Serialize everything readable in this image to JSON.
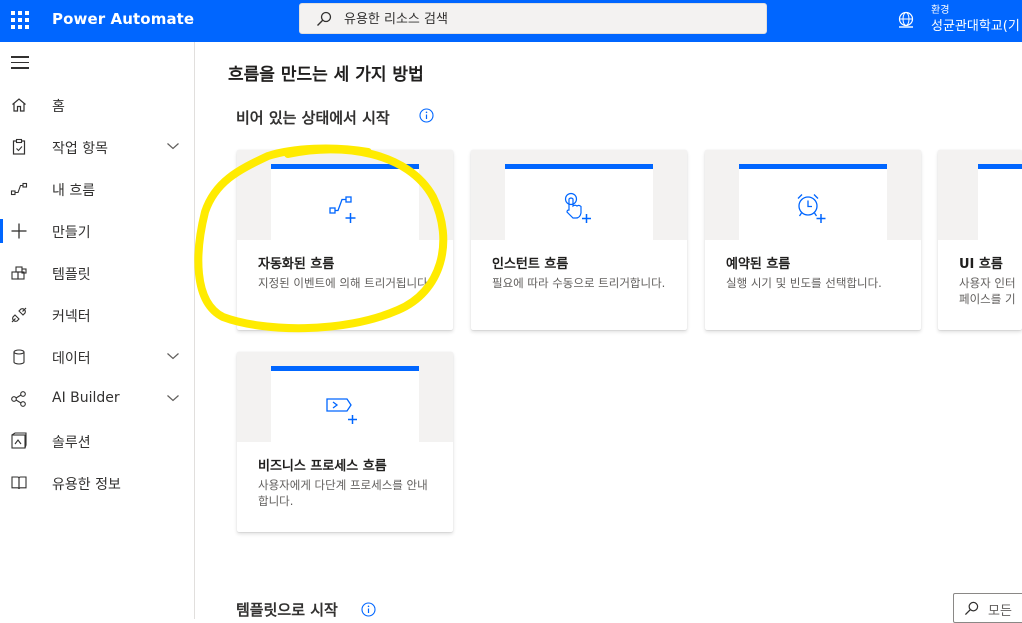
{
  "app": {
    "title": "Power Automate",
    "search_placeholder": "유용한 리소스 검색",
    "environment_label": "환경",
    "environment_name": "성균관대학교(기"
  },
  "sidebar": {
    "items": [
      {
        "label": "홈",
        "icon": "home-icon"
      },
      {
        "label": "작업 항목",
        "icon": "clipboard-icon",
        "expandable": true
      },
      {
        "label": "내 흐름",
        "icon": "flow-icon"
      },
      {
        "label": "만들기",
        "icon": "plus-icon",
        "active": true
      },
      {
        "label": "템플릿",
        "icon": "template-icon"
      },
      {
        "label": "커넥터",
        "icon": "connector-icon"
      },
      {
        "label": "데이터",
        "icon": "database-icon",
        "expandable": true
      },
      {
        "label": "AI Builder",
        "icon": "ai-builder-icon",
        "expandable": true
      },
      {
        "label": "솔루션",
        "icon": "solution-icon"
      },
      {
        "label": "유용한 정보",
        "icon": "book-icon"
      }
    ]
  },
  "main": {
    "page_title": "흐름을 만드는 세 가지 방법",
    "blank_section_title": "비어 있는 상태에서 시작",
    "template_section_title": "템플릿으로 시작",
    "template_search_text": "모든",
    "cards": [
      {
        "title": "자동화된 흐름",
        "description": "지정된 이벤트에 의해 트리거됩니다.",
        "icon": "automated-flow-icon"
      },
      {
        "title": "인스턴트 흐름",
        "description": "필요에 따라 수동으로 트리거합니다.",
        "icon": "touch-icon"
      },
      {
        "title": "예약된 흐름",
        "description": "실행 시기 및 빈도를 선택합니다.",
        "icon": "alarm-clock-icon"
      },
      {
        "title": "UI 흐름",
        "description": "사용자 인터페이스를 기록합",
        "icon": "ui-flow-icon"
      },
      {
        "title": "비즈니스 프로세스 흐름",
        "description": "사용자에게 다단계 프로세스를 안내합니다.",
        "icon": "business-process-icon"
      }
    ]
  },
  "colors": {
    "brand": "#0066ff",
    "annotation_highlight": "#ffeb00"
  }
}
